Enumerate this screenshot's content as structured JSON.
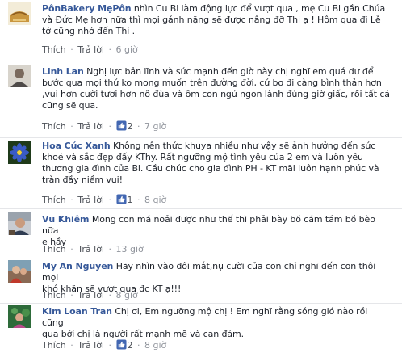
{
  "colors": {
    "link": "#365899",
    "muted": "#90949c",
    "text": "#1d2129",
    "like_blue": "#4267b2"
  },
  "actions": {
    "like": "Thích",
    "reply": "Trả lời",
    "separator": "·"
  },
  "comments": [
    {
      "name": "PônBakery MẹPôn",
      "text": " nhìn Cu Bi làm động lực để vượt qua , mẹ Cu Bi gần Chúa",
      "text2": "và Đức Mẹ hơn nữa thì mọi gánh nặng sẽ được nâng đỡ Thi ạ ! Hôm qua đi Lễ",
      "text3": "tớ cũng nhớ đến Thi .",
      "likes": "",
      "time": "6 giờ"
    },
    {
      "name": "Linh Lan",
      "text": " Nghị lực bản lĩnh và sức mạnh đến giờ này chị nghĩ em quá dư để",
      "text2": "bước qua mọi thứ ko mong muốn trên đường đời, cứ bơ đi càng bình thản hơn",
      "text3": ",vui hơn cười tươi hơn nô đùa và ôm con ngủ ngon lành đúng giờ giấc, rồi tất cả",
      "text4": "cũng sẽ qua.",
      "likes": "2",
      "time": "7 giờ"
    },
    {
      "name": "Hoa Cúc Xanh",
      "text": " Không nên thức khuya nhiều như vậy sẽ ảnh hưởng đến sức",
      "text2": "khoẻ và sắc đẹp đấy KThy. Rất ngưỡng mộ tình yêu của 2 em và luôn yêu",
      "text3": "thương gia đình của Bi. Cầu chúc cho gia đình PH - KT mãi luôn hạnh phúc và",
      "text4": "tràn đầy niềm vui!",
      "likes": "1",
      "time": "8 giờ"
    },
    {
      "name": "Vũ Khiêm",
      "text": " Mong con má noải được như thế thì phải bày bồ cám tám bồ bèo nữa",
      "text2": "e hầy",
      "likes": "",
      "time": "13 giờ"
    },
    {
      "name": "My An Nguyen",
      "text": " Hãy nhìn vào đôi mắt,nụ cười của con chỉ nghĩ đến con thôi mọi",
      "text2": "khó khăn sẽ vượt qua đc KT ạ!!!",
      "likes": "",
      "time": "8 giờ"
    },
    {
      "name": "Kim Loan Tran",
      "text": " Chị ơi, Em ngưỡng mộ chị ! Em nghĩ rằng sóng gió nào rồi cũng",
      "text2": "qua bởi chị là người rất mạnh mẽ và can đảm.",
      "likes": "2",
      "time": "8 giờ"
    }
  ]
}
